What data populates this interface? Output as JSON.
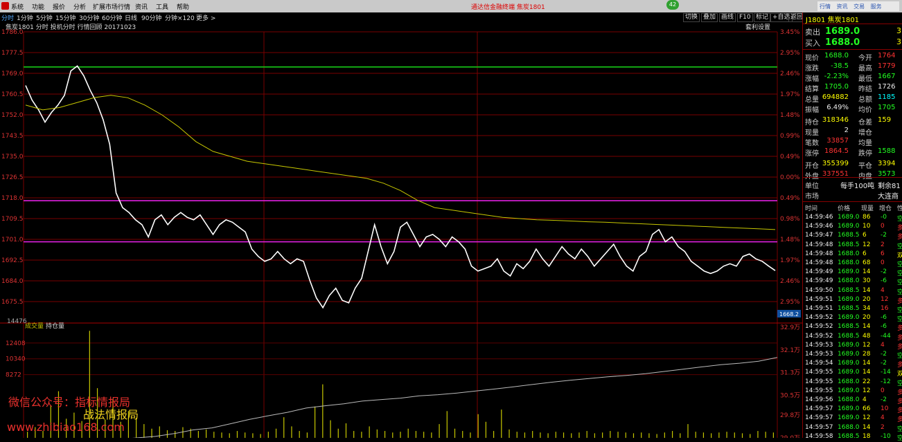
{
  "menu": {
    "items": [
      "系统",
      "功能",
      "报价",
      "分析",
      "扩展市场行情",
      "资讯",
      "工具",
      "帮助"
    ],
    "title": "通达信金融终端  焦炭1801",
    "badge": "42",
    "right_buttons": [
      "行情",
      "资讯",
      "交易",
      "服务"
    ]
  },
  "periods": {
    "items": [
      "分时",
      "1分钟",
      "5分钟",
      "15分钟",
      "30分钟",
      "60分钟",
      "日线",
      "90分钟",
      "分钟×120",
      "更多 >"
    ],
    "tools": [
      "切换",
      "叠加",
      "画线",
      "F10",
      "标记",
      "+自选",
      "返回"
    ]
  },
  "chart": {
    "info_line": "焦炭1801  分时  投机分时  行情回顾 20171023",
    "arb_label": "套利设置",
    "price_labels": [
      "1786.0",
      "1777.5",
      "1769.0",
      "1760.5",
      "1752.0",
      "1743.5",
      "1735.0",
      "1726.5",
      "1718.0",
      "1709.5",
      "1701.0",
      "1692.5",
      "1684.0",
      "1675.5"
    ],
    "pct_labels": [
      "3.45%",
      "2.95%",
      "2.46%",
      "1.97%",
      "1.48%",
      "0.99%",
      "0.49%",
      "0.00%",
      "0.49%",
      "0.98%",
      "1.48%",
      "1.97%",
      "2.46%",
      "2.95%"
    ],
    "cursor_price": "1668.2",
    "vol_top": "14476",
    "vol_labels": [
      "12408",
      "10340",
      "8272"
    ],
    "vol_legend": [
      "成交量",
      "持仓量"
    ],
    "oi_labels": [
      "32.9万",
      "32.1万",
      "31.3万",
      "30.5万",
      "29.8万",
      "29.0万"
    ]
  },
  "chart_data": {
    "type": "line",
    "title": "",
    "y_range": [
      1667.0,
      1786.0
    ],
    "ref_price": 1726.5,
    "series": [
      {
        "name": "",
        "color": "#ffffff",
        "values": [
          1764,
          1758,
          1754,
          1749,
          1753,
          1756,
          1760,
          1770,
          1772,
          1768,
          1762,
          1757,
          1750,
          1740,
          1720,
          1714,
          1712,
          1709,
          1707,
          1702,
          1709,
          1711,
          1707,
          1710,
          1712,
          1710,
          1709,
          1711,
          1707,
          1703,
          1707,
          1709,
          1708,
          1706,
          1704,
          1697,
          1694,
          1692,
          1693,
          1696,
          1693,
          1691,
          1693,
          1692,
          1684,
          1677,
          1673,
          1678,
          1681,
          1676,
          1675,
          1681,
          1685,
          1696,
          1707,
          1698,
          1691,
          1696,
          1706,
          1708,
          1703,
          1698,
          1702,
          1703,
          1701,
          1698,
          1702,
          1700,
          1697,
          1690,
          1688,
          1689,
          1690,
          1693,
          1688,
          1686,
          1691,
          1689,
          1692,
          1697,
          1693,
          1690,
          1694,
          1698,
          1695,
          1693,
          1697,
          1694,
          1690,
          1693,
          1696,
          1699,
          1694,
          1690,
          1688,
          1694,
          1696,
          1703,
          1705,
          1700,
          1702,
          1698,
          1696,
          1692,
          1690,
          1688,
          1687,
          1688,
          1690,
          1691,
          1690,
          1694,
          1695,
          1693,
          1692,
          1690,
          1688.2
        ]
      },
      {
        "name": "",
        "color": "#c8c800",
        "values": [
          1756,
          1754,
          1755,
          1757,
          1759,
          1760,
          1759,
          1756,
          1752,
          1747,
          1741,
          1737,
          1735,
          1733,
          1732,
          1731,
          1730,
          1729,
          1728,
          1727,
          1726,
          1724,
          1721,
          1717,
          1714,
          1713,
          1712,
          1711,
          1710,
          1709.5,
          1709,
          1708.8,
          1708.5,
          1708.2,
          1708,
          1707.7,
          1707.4,
          1707.1,
          1706.8,
          1706.5,
          1706.2,
          1705.9,
          1705.6,
          1705.3,
          1705
        ]
      }
    ],
    "levels": [
      {
        "value": 1771.6,
        "color": "#17c817"
      },
      {
        "value": 1716.8,
        "color": "#e020e0"
      },
      {
        "value": 1700.0,
        "color": "#e020e0"
      }
    ],
    "volume": {
      "y_range": [
        0,
        14476
      ],
      "values": [
        800,
        1400,
        900,
        4200,
        6100,
        2500,
        3300,
        2200,
        14000,
        6500,
        2400,
        5100,
        2100,
        3500,
        2600,
        1800,
        1200,
        1500,
        1000,
        900,
        1400,
        1200,
        900,
        1100,
        800,
        700,
        600,
        900,
        700,
        600,
        500,
        800,
        1200,
        2700,
        1500,
        900,
        700,
        4100,
        7000,
        2300,
        1200,
        1900,
        900,
        800,
        1500,
        1100,
        900,
        700,
        800,
        1200,
        900,
        800,
        700,
        1800,
        3500,
        1200,
        900,
        700,
        3100,
        2100,
        900,
        3700,
        1100,
        800,
        700,
        900,
        700,
        600,
        800,
        700,
        600,
        700,
        900,
        600,
        700,
        900,
        800,
        700,
        600,
        700,
        600,
        500,
        700,
        900,
        600,
        1800,
        800,
        700,
        600,
        700,
        800,
        700,
        600,
        500,
        900,
        800,
        700
      ]
    },
    "open_interest": {
      "y_range": [
        290000,
        329000
      ],
      "values": [
        289000,
        288800,
        288500,
        288700,
        289200,
        289500,
        290000,
        290500,
        291500,
        292800,
        293500,
        295000,
        296500,
        297800,
        299000,
        300500,
        301300,
        302000,
        303000,
        303500,
        304000,
        304800,
        305200,
        305800,
        306500,
        307200,
        308000,
        308800,
        309600,
        310300,
        310900,
        311500,
        312000,
        312600,
        313400,
        314200,
        315000,
        315800,
        316300,
        317000,
        318346
      ]
    }
  },
  "quote": {
    "code": "J1801",
    "name": "焦炭1801",
    "ask_label": "卖出",
    "ask_price": "1689.0",
    "ask_vol": "3",
    "bid_label": "买入",
    "bid_price": "1688.0",
    "bid_vol": "3",
    "rows": [
      {
        "l1": "现价",
        "v1": "1688.0",
        "c1": "g",
        "l2": "今开",
        "v2": "1764",
        "c2": "r"
      },
      {
        "l1": "涨跌",
        "v1": "-38.5",
        "c1": "g",
        "l2": "最高",
        "v2": "1779",
        "c2": "r"
      },
      {
        "l1": "涨幅",
        "v1": "-2.23%",
        "c1": "g",
        "l2": "最低",
        "v2": "1667",
        "c2": "g"
      },
      {
        "l1": "结算",
        "v1": "1705.0",
        "c1": "g",
        "l2": "昨结",
        "v2": "1726",
        "c2": "w"
      },
      {
        "l1": "总量",
        "v1": "694882",
        "c1": "y",
        "l2": "总额",
        "v2": "1185",
        "c2": "c"
      },
      {
        "l1": "振幅",
        "v1": "6.49%",
        "c1": "w",
        "l2": "均价",
        "v2": "1705",
        "c2": "g"
      },
      {
        "l1": "持仓",
        "v1": "318346",
        "c1": "y",
        "l2": "仓差",
        "v2": "159",
        "c2": "y"
      },
      {
        "l1": "现量",
        "v1": "2",
        "c1": "w",
        "l2": "增仓",
        "v2": "",
        "c2": "w"
      },
      {
        "l1": "笔数",
        "v1": "33857",
        "c1": "r",
        "l2": "均量",
        "v2": "",
        "c2": "w"
      },
      {
        "l1": "涨停",
        "v1": "1864.5",
        "c1": "r",
        "l2": "跌停",
        "v2": "1588",
        "c2": "g"
      },
      {
        "l1": "开仓",
        "v1": "355399",
        "c1": "y",
        "l2": "平仓",
        "v2": "3394",
        "c2": "y"
      },
      {
        "l1": "外盘",
        "v1": "337551",
        "c1": "r",
        "l2": "内盘",
        "v2": "3573",
        "c2": "g"
      }
    ],
    "unit_label": "单位",
    "unit_value": "每手100吨",
    "remain_label": "剩余81",
    "market_label": "市场",
    "market_value": "大连商"
  },
  "ticks": {
    "headers": [
      "时间",
      "价格",
      "现量",
      "增仓",
      "性"
    ],
    "rows": [
      [
        "14:59:46",
        "1689.0",
        "86",
        "-0",
        "空"
      ],
      [
        "14:59:46",
        "1689.0",
        "10",
        "0",
        "多"
      ],
      [
        "14:59:47",
        "1688.5",
        "6",
        "-2",
        "多"
      ],
      [
        "14:59:48",
        "1688.5",
        "12",
        "2",
        "空"
      ],
      [
        "14:59:48",
        "1688.0",
        "6",
        "6",
        "双"
      ],
      [
        "14:59:48",
        "1688.0",
        "68",
        "0",
        "空"
      ],
      [
        "14:59:49",
        "1689.0",
        "14",
        "-2",
        "空"
      ],
      [
        "14:59:49",
        "1688.0",
        "30",
        "-6",
        "空"
      ],
      [
        "14:59:50",
        "1688.5",
        "14",
        "4",
        "空"
      ],
      [
        "14:59:51",
        "1689.0",
        "20",
        "12",
        "多"
      ],
      [
        "14:59:51",
        "1688.5",
        "34",
        "16",
        "空"
      ],
      [
        "14:59:52",
        "1689.0",
        "20",
        "-6",
        "空"
      ],
      [
        "14:59:52",
        "1688.5",
        "14",
        "-6",
        "多"
      ],
      [
        "14:59:52",
        "1688.5",
        "48",
        "-44",
        "多"
      ],
      [
        "14:59:53",
        "1689.0",
        "12",
        "4",
        "多"
      ],
      [
        "14:59:53",
        "1689.0",
        "28",
        "-2",
        "空"
      ],
      [
        "14:59:54",
        "1689.0",
        "14",
        "-2",
        "多"
      ],
      [
        "14:59:55",
        "1689.0",
        "14",
        "-14",
        "双"
      ],
      [
        "14:59:55",
        "1688.0",
        "22",
        "-12",
        "空"
      ],
      [
        "14:59:55",
        "1689.0",
        "12",
        "0",
        "多"
      ],
      [
        "14:59:56",
        "1688.0",
        "4",
        "-2",
        "多"
      ],
      [
        "14:59:57",
        "1689.0",
        "66",
        "10",
        "多"
      ],
      [
        "14:59:57",
        "1689.0",
        "12",
        "4",
        "多"
      ],
      [
        "14:59:57",
        "1688.0",
        "14",
        "2",
        "空"
      ],
      [
        "14:59:58",
        "1688.5",
        "18",
        "-10",
        "空"
      ]
    ]
  },
  "watermark": {
    "line1": "微信公众号：指标情报局",
    "line2": "战法情报局",
    "line3": "www.zhibiao168.com"
  }
}
